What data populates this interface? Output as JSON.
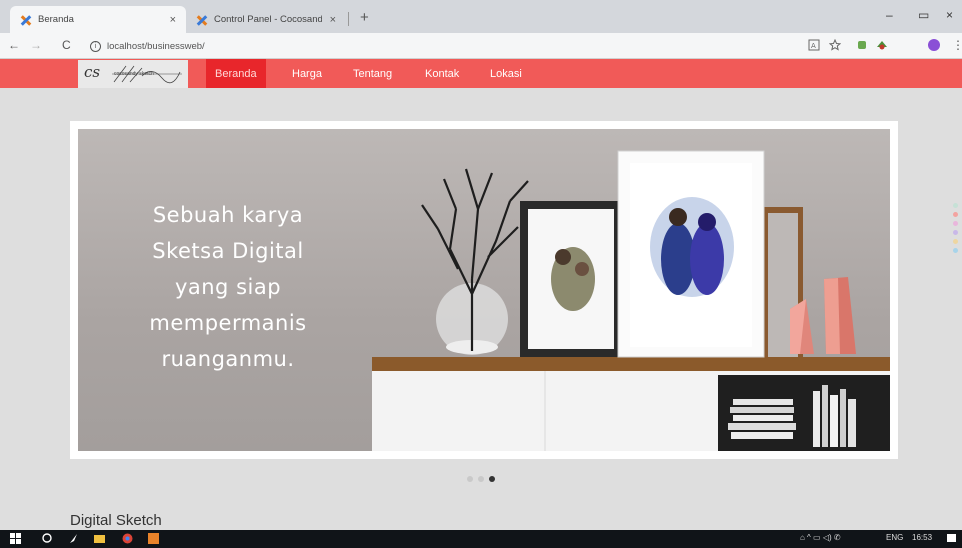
{
  "browser": {
    "tabs": [
      {
        "title": "Beranda",
        "close": "×"
      },
      {
        "title": "Control Panel - Cocosandy Sket",
        "close": "×"
      }
    ],
    "new_tab": "+",
    "window_controls": {
      "minimize": "–",
      "maximize": "▭",
      "close": "×"
    },
    "nav": {
      "back": "←",
      "forward": "→",
      "reload": "C"
    },
    "address": "localhost/businessweb/",
    "info_icon": "i"
  },
  "site": {
    "logo": {
      "mark": "cs",
      "text": "cocosandy sketch"
    },
    "nav": [
      "Beranda",
      "Harga",
      "Tentang",
      "Kontak",
      "Lokasi"
    ],
    "hero_lines": [
      "Sebuah karya",
      "Sketsa Digital",
      "yang siap",
      "mempermanis",
      "ruanganmu."
    ],
    "section_title": "Digital Sketch"
  },
  "colors": {
    "nav_bg": "#f15a58",
    "nav_active": "#e8262b",
    "side_dots": [
      "#c6e1d6",
      "#f3a3a0",
      "#e9b6dc",
      "#c9b8e8",
      "#eed6a1",
      "#a8d4ea"
    ]
  },
  "taskbar": {
    "tray_text": "ENG",
    "time": "16:53"
  }
}
